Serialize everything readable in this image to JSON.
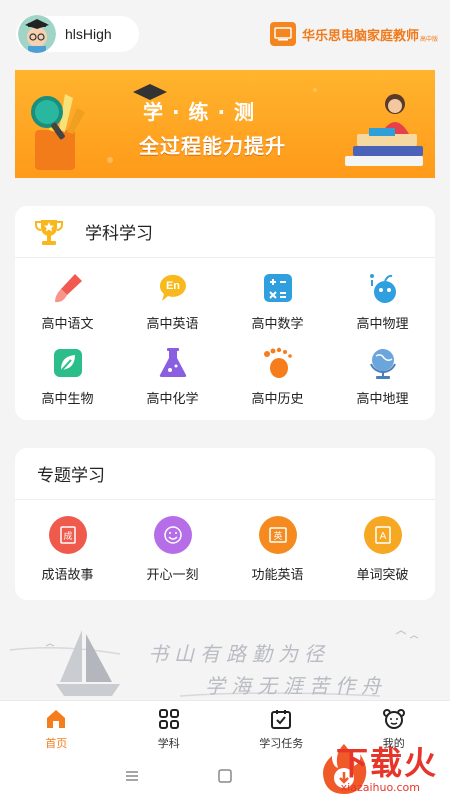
{
  "header": {
    "username": "hlsHigh",
    "brand_title": "华乐思电脑家庭教师",
    "brand_sub": "高中版"
  },
  "banner": {
    "line1": "学 · 练 · 测",
    "line2": "全过程能力提升"
  },
  "subject_section": {
    "title": "学科学习",
    "items": [
      {
        "label": "高中语文",
        "icon": "brush-icon"
      },
      {
        "label": "高中英语",
        "icon": "english-bubble-icon"
      },
      {
        "label": "高中数学",
        "icon": "calculator-icon"
      },
      {
        "label": "高中物理",
        "icon": "apple-physics-icon"
      },
      {
        "label": "高中生物",
        "icon": "leaf-icon"
      },
      {
        "label": "高中化学",
        "icon": "flask-icon"
      },
      {
        "label": "高中历史",
        "icon": "footprint-icon"
      },
      {
        "label": "高中地理",
        "icon": "globe-icon"
      }
    ]
  },
  "topic_section": {
    "title": "专题学习",
    "items": [
      {
        "label": "成语故事",
        "glyph": "成",
        "color": "#ef5a4c"
      },
      {
        "label": "开心一刻",
        "glyph": "☺",
        "color": "#b56ee8"
      },
      {
        "label": "功能英语",
        "glyph": "英",
        "color": "#f58a1f"
      },
      {
        "label": "单词突破",
        "glyph": "A",
        "color": "#f7a823"
      }
    ]
  },
  "motto": {
    "line1": "书山有路勤为径",
    "line2": "学海无涯苦作舟"
  },
  "tabbar": {
    "tabs": [
      {
        "label": "首页",
        "icon": "home-icon",
        "active": true
      },
      {
        "label": "学科",
        "icon": "grid-icon",
        "active": false
      },
      {
        "label": "学习任务",
        "icon": "calendar-check-icon",
        "active": false
      },
      {
        "label": "我的",
        "icon": "bear-face-icon",
        "active": false
      }
    ]
  },
  "watermark": {
    "text": "下载火",
    "url": "xiazaihuo.com"
  },
  "colors": {
    "accent": "#f57d1c",
    "banner": "#ffa726",
    "watermark": "#e8352a"
  }
}
